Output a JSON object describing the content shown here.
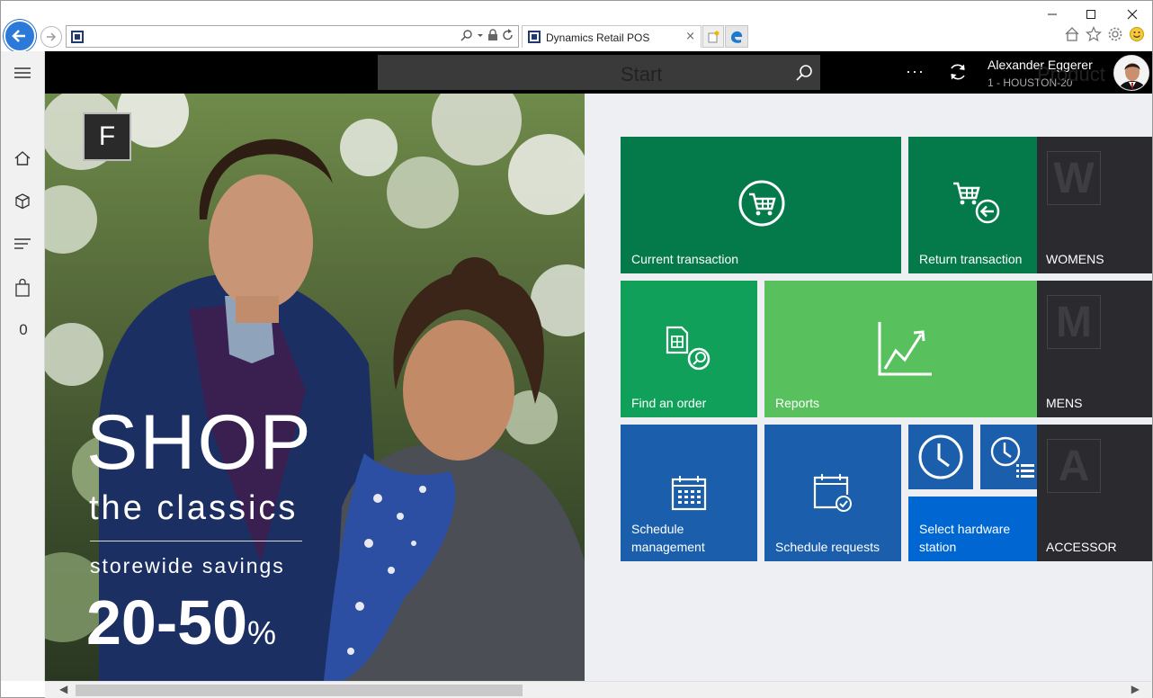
{
  "browser": {
    "tab_title": "Dynamics Retail POS",
    "tab_close": "×",
    "address_value": "",
    "window_controls": [
      "minimize-icon",
      "maximize-icon",
      "close-icon"
    ]
  },
  "topbar": {
    "search_placeholder": "",
    "more": "···",
    "user_name": "Alexander Eggerer",
    "store": "1 - HOUSTON-20"
  },
  "leftnav": {
    "icons": [
      "hamburger-icon",
      "home-icon",
      "products-icon",
      "lines-icon",
      "bag-icon"
    ],
    "cart_count": "0"
  },
  "hero": {
    "logo_letter": "F",
    "shop": "SHOP",
    "classics": "the classics",
    "savings": "storewide savings",
    "percent": "20-50",
    "percent_sign": "%"
  },
  "start": {
    "title": "Start",
    "tiles": {
      "current_transaction": "Current transaction",
      "return_transaction": "Return transaction",
      "find_order": "Find an order",
      "reports": "Reports",
      "schedule_management_1": "Schedule",
      "schedule_management_2": "management",
      "schedule_requests": "Schedule requests",
      "select_hw_1": "Select hardware",
      "select_hw_2": "station"
    }
  },
  "products": {
    "title": "Product",
    "items": [
      {
        "letter": "W",
        "label": "WOMENS"
      },
      {
        "letter": "M",
        "label": "MENS"
      },
      {
        "letter": "A",
        "label": "ACCESSOR"
      }
    ]
  },
  "colors": {
    "dark_green": "#047a4a",
    "mid_green": "#10a05a",
    "light_green": "#58c15e",
    "dark_blue": "#1b5fac",
    "bright_blue": "#0067d2",
    "topbar": "#000000"
  }
}
